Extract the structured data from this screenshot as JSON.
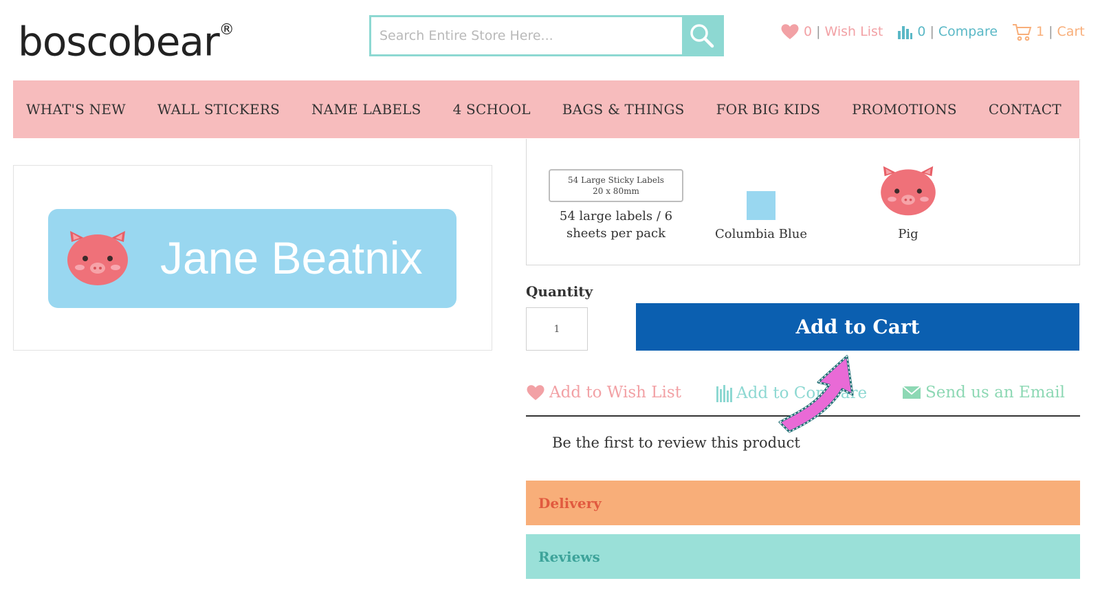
{
  "brand": {
    "logo_text": "boscobear",
    "reg_mark": "®"
  },
  "search": {
    "placeholder": "Search Entire Store Here..."
  },
  "top_links": {
    "wishlist": {
      "count": "0",
      "label": "Wish List"
    },
    "compare": {
      "count": "0",
      "label": "Compare"
    },
    "cart": {
      "count": "1",
      "label": "Cart"
    }
  },
  "nav": {
    "items": [
      "WHAT'S NEW",
      "WALL STICKERS",
      "NAME LABELS",
      "4 SCHOOL",
      "BAGS & THINGS",
      "FOR BIG KIDS",
      "PROMOTIONS",
      "CONTACT"
    ]
  },
  "preview": {
    "name": "Jane Beatnix"
  },
  "options": {
    "size": {
      "box_line1": "54 Large Sticky Labels",
      "box_line2": "20 x 80mm",
      "label_line1": "54 large labels / 6",
      "label_line2": "sheets per pack"
    },
    "color": {
      "label": "Columbia Blue",
      "hex": "#99d7f0"
    },
    "icon": {
      "label": "Pig"
    }
  },
  "purchase": {
    "quantity_label": "Quantity",
    "quantity_value": "1",
    "add_to_cart": "Add to Cart"
  },
  "actions": {
    "wishlist": "Add to Wish List",
    "compare": "Add to Compare",
    "email": "Send us an Email"
  },
  "review": {
    "text": "Be the first to review this product"
  },
  "accordions": {
    "delivery": "Delivery",
    "reviews": "Reviews"
  },
  "colors": {
    "nav_bg": "#f7bcbd",
    "teal": "#8dd8d2",
    "wish_pink": "#f2a1a5",
    "cart_orange": "#f8ae79",
    "primary_blue": "#0b5fb0",
    "delivery_text": "#e15a3f",
    "reviews_text": "#3da39a"
  }
}
